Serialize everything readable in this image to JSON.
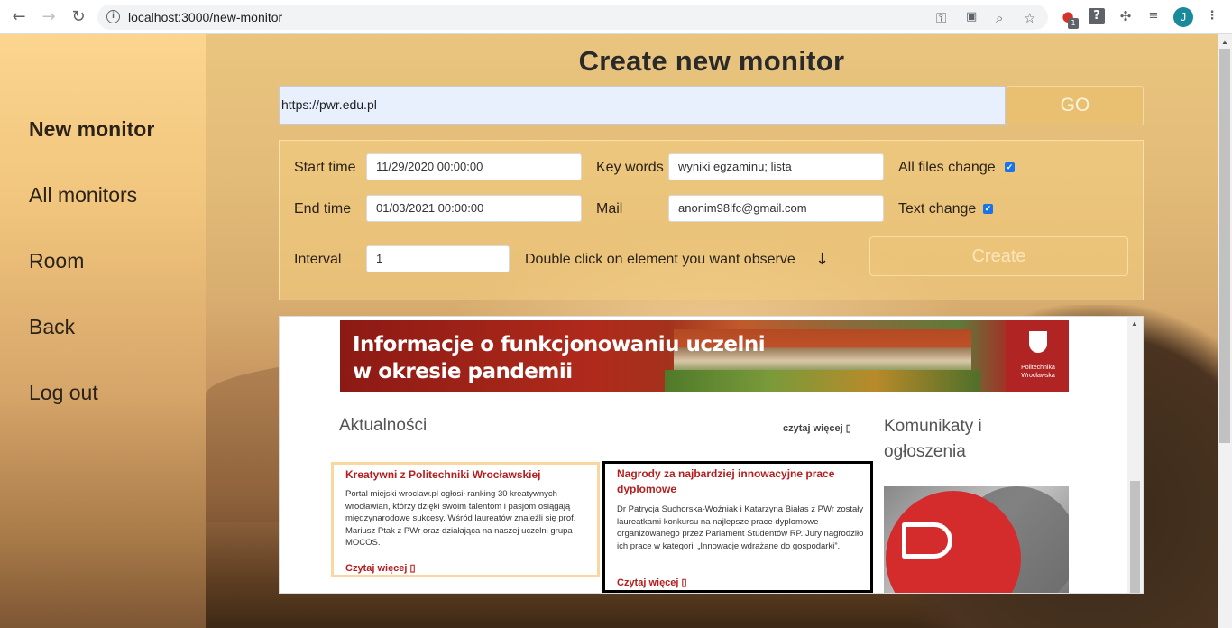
{
  "browser": {
    "url": "localhost:3000/new-monitor",
    "back_icon": "←",
    "forward_icon": "→",
    "reload_icon": "↻",
    "info_icon": "i",
    "avatar_letter": "J",
    "ext_badge": "1"
  },
  "sidebar": {
    "items": [
      {
        "label": "New monitor"
      },
      {
        "label": "All monitors"
      },
      {
        "label": "Room"
      },
      {
        "label": "Back"
      },
      {
        "label": "Log out"
      }
    ]
  },
  "main": {
    "title": "Create new monitor",
    "url_value": "https://pwr.edu.pl",
    "go_label": "GO",
    "form": {
      "start_time_label": "Start time",
      "start_time_value": "11/29/2020 00:00:00",
      "end_time_label": "End time",
      "end_time_value": "01/03/2021 00:00:00",
      "interval_label": "Interval",
      "interval_value": "1",
      "key_words_label": "Key words",
      "key_words_value": "wyniki egzaminu; lista",
      "mail_label": "Mail",
      "mail_value": "anonim98lfc@gmail.com",
      "all_files_label": "All files change",
      "all_files_checked": true,
      "text_change_label": "Text change",
      "text_change_checked": true,
      "hint": "Double click on element you want observe",
      "hint_arrow": "↓",
      "create_label": "Create"
    }
  },
  "preview": {
    "banner_line1": "Informacje o funkcjonowaniu uczelni",
    "banner_line2": "w okresie pandemii",
    "banner_logo": "Politechnika Wrocławska",
    "aktualnosci": "Aktualności",
    "czytaj_wiecej_top": "czytaj więcej ▯",
    "komunikaty": "Komunikaty i ogłoszenia",
    "card1": {
      "title": "Kreatywni z Politechniki Wrocławskiej",
      "text": "Portal miejski wroclaw.pl ogłosił ranking 30 kreatywnych wrocławian, którzy dzięki swoim talentom i pasjom osiągają międzynarodowe sukcesy. Wśród laureatów znaleźli się prof. Mariusz Ptak z PWr oraz działająca na naszej uczelni grupa MOCOS.",
      "more": "Czytaj więcej ▯"
    },
    "card2": {
      "title": "Nagrody za najbardziej innowacyjne prace dyplomowe",
      "text": "Dr Patrycja Suchorska-Woźniak i Katarzyna Białas z PWr zostały laureatkami konkursu na najlepsze prace dyplomowe organizowanego przez Parlament Studentów RP. Jury nagrodziło ich prace w kategorii „Innowacje wdrażane do gospodarki”.",
      "more": "Czytaj więcej ▯"
    }
  }
}
